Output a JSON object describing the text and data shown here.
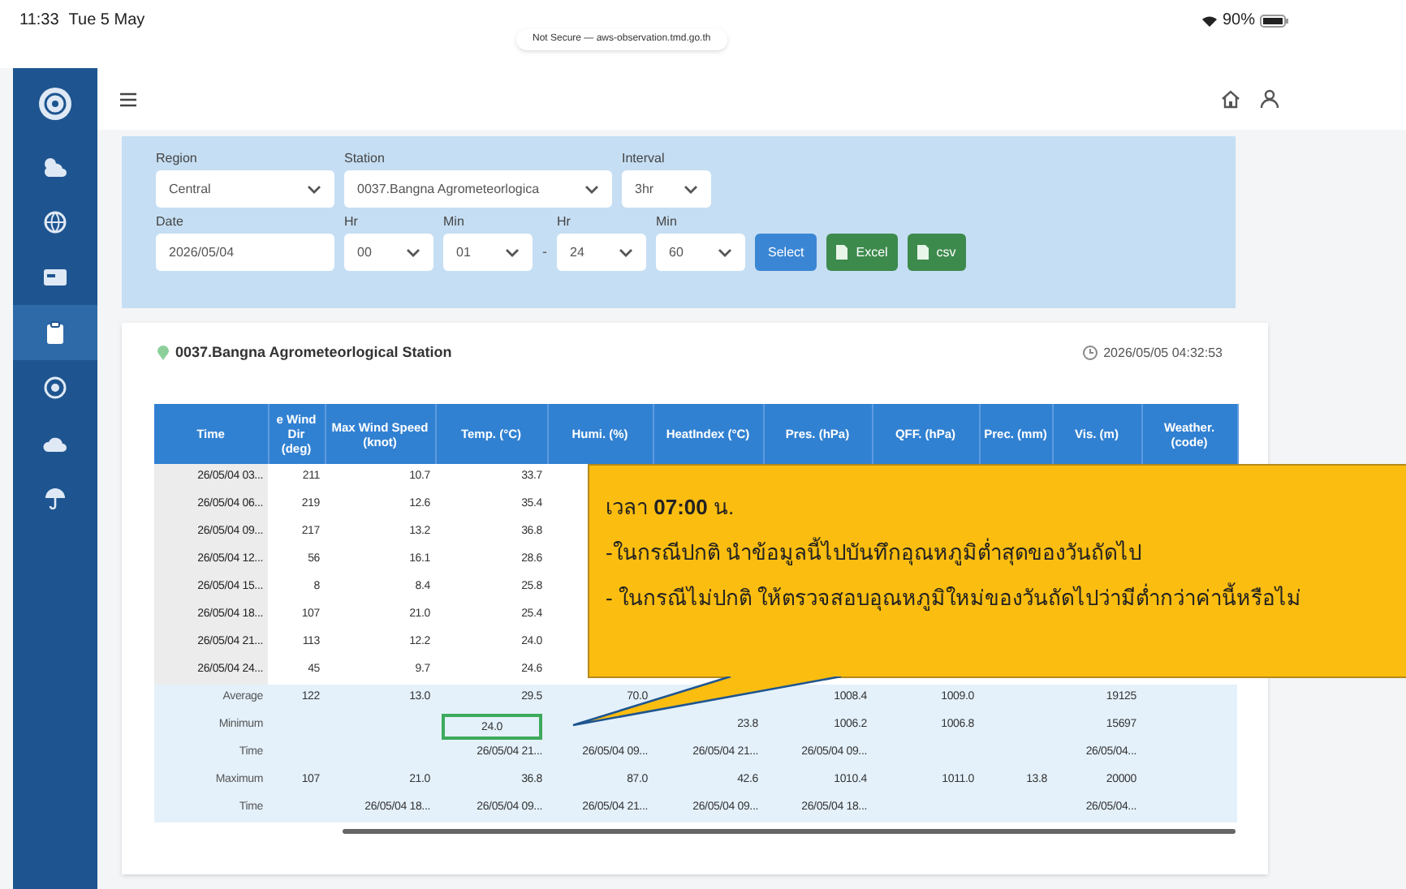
{
  "status_bar": {
    "time": "11:33",
    "date": "Tue 5 May",
    "battery": "90%"
  },
  "url_bar": {
    "text": "Not Secure — aws-observation.tmd.go.th"
  },
  "sidebar": {
    "items": [
      {
        "selected": false
      },
      {
        "selected": false
      },
      {
        "selected": false
      },
      {
        "selected": false
      },
      {
        "selected": true
      },
      {
        "selected": false
      },
      {
        "selected": false
      },
      {
        "selected": false
      }
    ]
  },
  "filters": {
    "region": {
      "label": "Region",
      "value": "Central"
    },
    "station": {
      "label": "Station",
      "value": "0037.Bangna Agrometeorlogica"
    },
    "interval": {
      "label": "Interval",
      "value": "3hr"
    },
    "date": {
      "label": "Date",
      "value": "2026/05/04"
    },
    "hr_from": {
      "label": "Hr",
      "value": "00"
    },
    "min_from": {
      "label": "Min",
      "value": "01"
    },
    "separator": "-",
    "hr_to": {
      "label": "Hr",
      "value": "24"
    },
    "min_to": {
      "label": "Min",
      "value": "60"
    },
    "buttons": [
      {
        "label": "Select",
        "kind": "primary"
      },
      {
        "label": "Excel",
        "kind": "export"
      },
      {
        "label": "csv",
        "kind": "export"
      }
    ]
  },
  "card": {
    "station": "0037.Bangna Agrometeorlogical Station",
    "updated": "2026/05/05 04:32:53"
  },
  "table": {
    "columns": [
      "Time",
      "e Wind Dir (deg)",
      "Max Wind Speed (knot)",
      "Temp. (°C)",
      "Humi. (%)",
      "HeatIndex (°C)",
      "Pres. (hPa)",
      "QFF. (hPa)",
      "Prec. (mm)",
      "Vis. (m)",
      "Weather. (code)"
    ],
    "rows": [
      {
        "kind": "data",
        "cells": [
          "26/05/04 03...",
          "211",
          "10.7",
          "33.7",
          null,
          null,
          null,
          null,
          null,
          null,
          null
        ]
      },
      {
        "kind": "data",
        "cells": [
          "26/05/04 06...",
          "219",
          "12.6",
          "35.4",
          null,
          null,
          null,
          null,
          null,
          null,
          null
        ]
      },
      {
        "kind": "data",
        "cells": [
          "26/05/04 09...",
          "217",
          "13.2",
          "36.8",
          null,
          null,
          null,
          null,
          null,
          null,
          null
        ]
      },
      {
        "kind": "data",
        "cells": [
          "26/05/04 12...",
          "56",
          "16.1",
          "28.6",
          null,
          null,
          null,
          null,
          null,
          null,
          null
        ]
      },
      {
        "kind": "data",
        "cells": [
          "26/05/04 15...",
          "8",
          "8.4",
          "25.8",
          null,
          null,
          null,
          null,
          null,
          null,
          null
        ]
      },
      {
        "kind": "data",
        "cells": [
          "26/05/04 18...",
          "107",
          "21.0",
          "25.4",
          null,
          null,
          null,
          null,
          null,
          null,
          null
        ]
      },
      {
        "kind": "data",
        "cells": [
          "26/05/04 21...",
          "113",
          "12.2",
          "24.0",
          null,
          null,
          null,
          null,
          null,
          null,
          null
        ]
      },
      {
        "kind": "data",
        "cells": [
          "26/05/04 24...",
          "45",
          "9.7",
          "24.6",
          null,
          null,
          null,
          null,
          null,
          null,
          null
        ]
      },
      {
        "kind": "summary",
        "cells": [
          "Average",
          "122",
          "13.0",
          "29.5",
          "70.0",
          null,
          "1008.4",
          "1009.0",
          null,
          "19125",
          null
        ]
      },
      {
        "kind": "summary",
        "cells": [
          "Minimum",
          null,
          null,
          {
            "text": "24.0",
            "boxed": true
          },
          null,
          "23.8",
          "1006.2",
          "1006.8",
          null,
          "15697",
          null
        ]
      },
      {
        "kind": "summary",
        "cells": [
          "Time",
          null,
          null,
          "26/05/04 21...",
          "26/05/04 09...",
          "26/05/04 21...",
          "26/05/04 09...",
          null,
          null,
          "26/05/04...",
          null
        ]
      },
      {
        "kind": "summary",
        "cells": [
          "Maximum",
          "107",
          "21.0",
          "36.8",
          "87.0",
          "42.6",
          "1010.4",
          "1011.0",
          "13.8",
          "20000",
          null
        ]
      },
      {
        "kind": "summary",
        "cells": [
          "Time",
          null,
          "26/05/04 18...",
          "26/05/04 09...",
          "26/05/04 21...",
          "26/05/04 09...",
          "26/05/04 18...",
          null,
          null,
          "26/05/04...",
          null
        ]
      }
    ]
  },
  "callout": {
    "lines": [
      "เวลา **07:00** น.",
      "-ในกรณีปกติ นำข้อมูลนี้ไปบันทึกอุณหภูมิต่ำสุดของวันถัดไป",
      "- ในกรณีไม่ปกติ ให้ตรวจสอบอุณหภูมิใหม่ของวันถัดไปว่ามีต่ำกว่าค่านี้หรือไม่"
    ]
  }
}
